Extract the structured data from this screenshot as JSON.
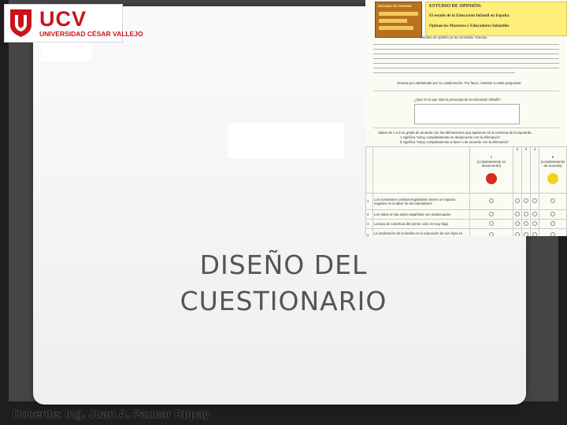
{
  "logo": {
    "name": "UCV",
    "subtitle": "UNIVERSIDAD CÉSAR VALLEJO",
    "brand_color": "#c9131a"
  },
  "slide": {
    "title_line1": "DISEÑO DEL",
    "title_line2": "CUESTIONARIO",
    "footer": "Docente: Ing. Juan A. Paucar Rupay"
  },
  "document_image": {
    "thumb_title": "ESTUDIO DE OPINIÓN",
    "header_line1": "ESTUDIO DE OPINIÓN:",
    "header_line2": "El estado de la Educación Infantil en España.",
    "header_line3": "Opinan los Maestros y Educadores Infantiles",
    "greeting": "Sondeo de opinión ya ha concluido. Gracias.",
    "thanks": "Gracias por adelantado por su colaboración. Por favor, conteste a estas preguntas:",
    "question": "¿Qué es lo que más le preocupa de la educación infantil?",
    "scale_caption": "Valore de 1 a 5 su grado de acuerdo con las afirmaciones que aparecen en la columna de la izquierda.",
    "scale_note1": "1 significa \"estoy completamente en desacuerdo con la afirmación\"",
    "scale_note2": "5 significa \"estoy completamente a favor o de acuerdo con la afirmación\"",
    "col_1": "1",
    "col_2": "2",
    "col_3": "3",
    "col_4": "4",
    "col_5": "5",
    "col_1_caption": "(completamente en desacuerdo)",
    "col_5_caption": "(completamente de acuerdo)",
    "rows": [
      {
        "n": "1",
        "text": "Los constantes cambios legislativos tienen un impacto negativo en la labor de los educadores"
      },
      {
        "n": "2",
        "text": "Los ratios en las aulas españolas son inadecuados"
      },
      {
        "n": "3",
        "text": "La tasa de cobertura del primer ciclo es muy baja"
      },
      {
        "n": "4",
        "text": "La implicación de la familia en la educación de sus hijos es baja"
      }
    ]
  }
}
